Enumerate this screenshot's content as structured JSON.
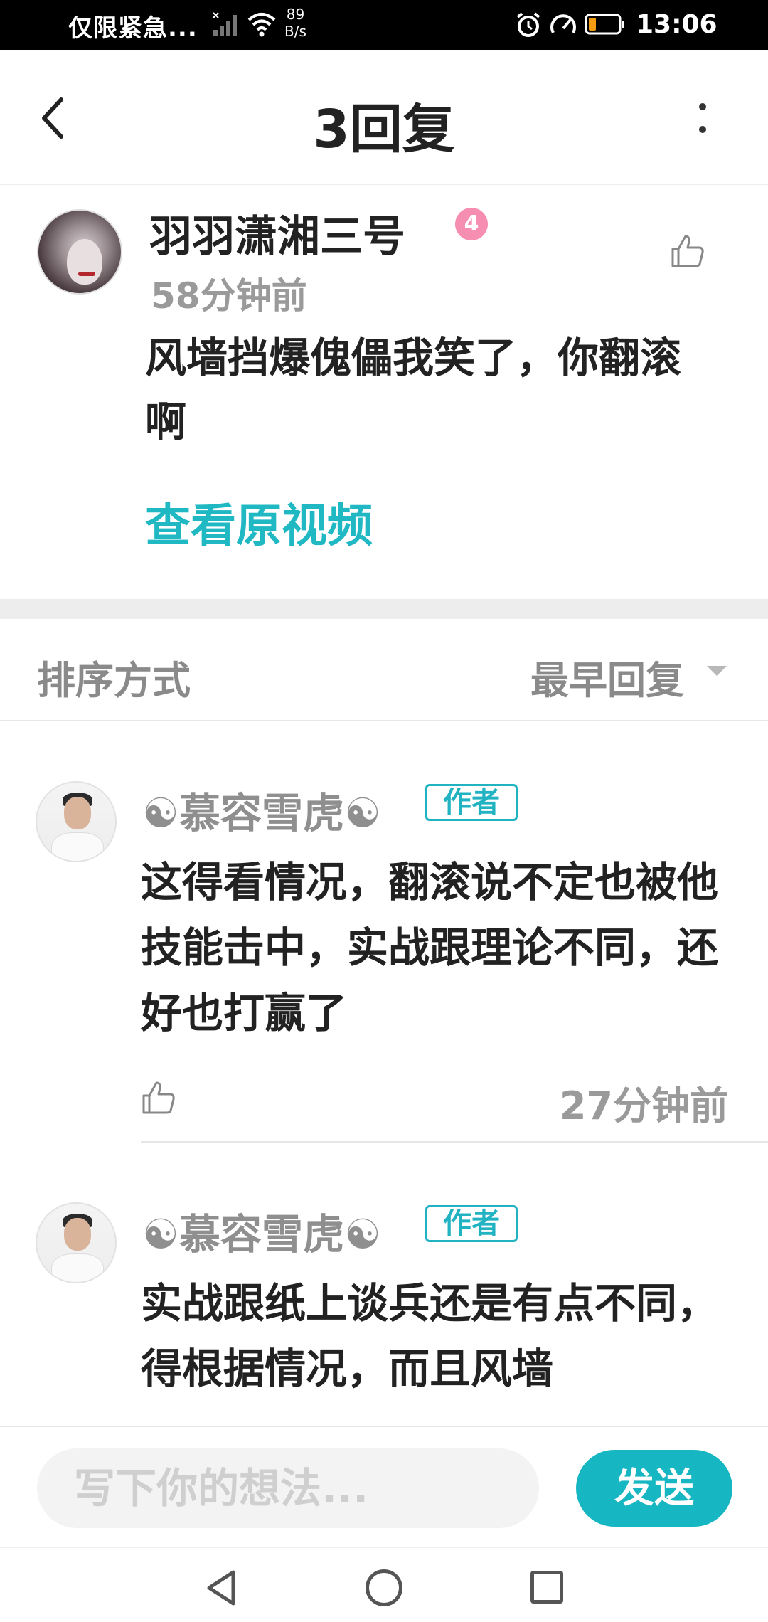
{
  "status_bar": {
    "carrier": "仅限紧急...",
    "net_speed_value": "89",
    "net_speed_unit": "B/s",
    "time": "13:06",
    "battery_color": "#f39c12"
  },
  "header": {
    "title": "3回复"
  },
  "main_comment": {
    "username": "羽羽潇湘三号",
    "level": "4",
    "time": "58分钟前",
    "text": "风墙挡爆傀儡我笑了，你翻滚啊",
    "view_video_link": "查看原视频"
  },
  "sort": {
    "label": "排序方式",
    "selected": "最早回复"
  },
  "replies": [
    {
      "username": "☯慕容雪虎☯",
      "tag": "作者",
      "text": "这得看情况，翻滚说不定也被他技能击中，实战跟理论不同，还好也打赢了",
      "time": "27分钟前"
    },
    {
      "username": "☯慕容雪虎☯",
      "tag": "作者",
      "text": "实战跟纸上谈兵还是有点不同，得根据情况，而且风墙"
    }
  ],
  "composer": {
    "placeholder": "写下你的想法...",
    "send_label": "发送"
  },
  "colors": {
    "accent": "#16b6c3",
    "level_badge": "#f58eb1",
    "muted_text": "#9a9a9a"
  }
}
